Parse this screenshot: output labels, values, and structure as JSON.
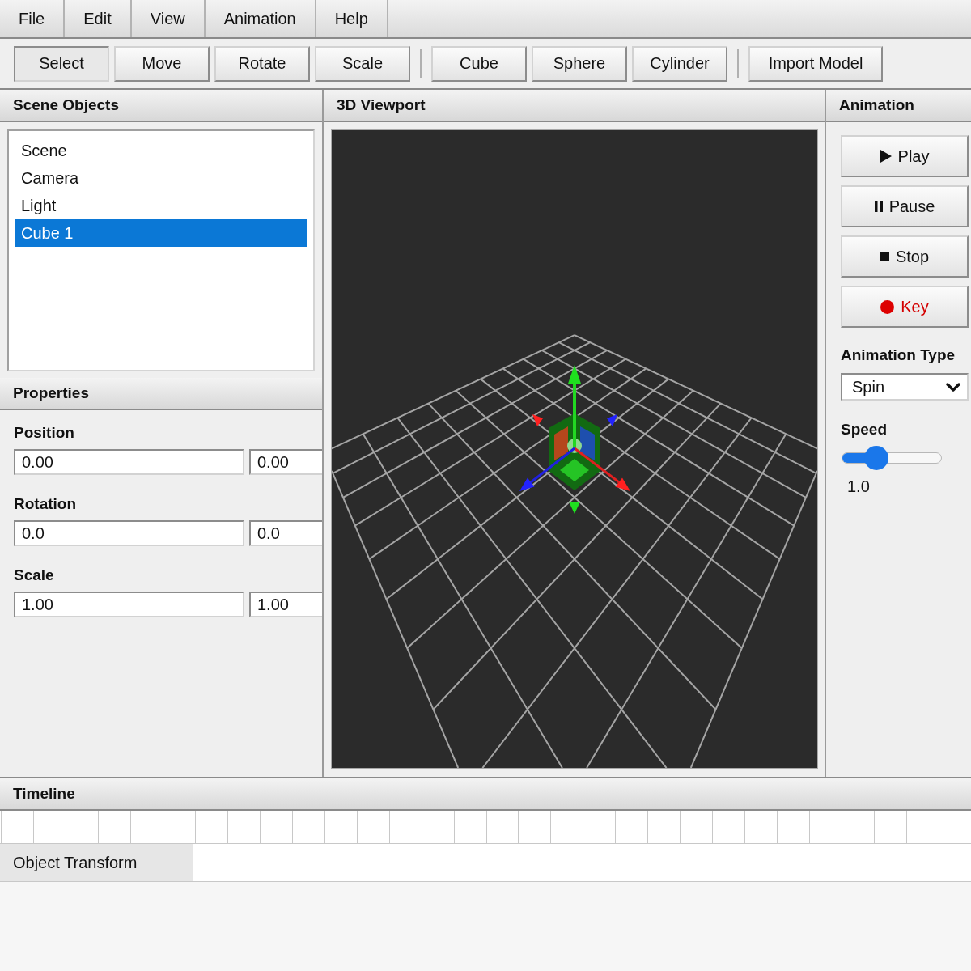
{
  "menu_bar": {
    "items": [
      "File",
      "Edit",
      "View",
      "Animation",
      "Help"
    ]
  },
  "toolbar": {
    "tool_buttons": [
      {
        "label": "Select",
        "selected": true
      },
      {
        "label": "Move",
        "selected": false
      },
      {
        "label": "Rotate",
        "selected": false
      },
      {
        "label": "Scale",
        "selected": false
      }
    ],
    "create_buttons": [
      "Cube",
      "Sphere",
      "Cylinder"
    ],
    "import_button": "Import Model"
  },
  "scene_panel": {
    "title": "Scene Objects",
    "objects": [
      {
        "label": "Scene",
        "selected": false
      },
      {
        "label": "Camera",
        "selected": false
      },
      {
        "label": "Light",
        "selected": false
      },
      {
        "label": "Cube 1",
        "selected": true
      }
    ]
  },
  "properties_panel": {
    "title": "Properties",
    "groups": [
      {
        "label": "Position",
        "values": [
          "0.00",
          "0.00"
        ]
      },
      {
        "label": "Rotation",
        "values": [
          "0.0",
          "0.0"
        ]
      },
      {
        "label": "Scale",
        "values": [
          "1.00",
          "1.00"
        ]
      }
    ]
  },
  "viewport": {
    "title": "3D Viewport"
  },
  "animation_panel": {
    "title": "Animation",
    "buttons": [
      {
        "kind": "play",
        "label": "Play"
      },
      {
        "kind": "pause",
        "label": "Pause"
      },
      {
        "kind": "stop",
        "label": "Stop"
      },
      {
        "kind": "record",
        "label": "Key"
      }
    ],
    "type_label": "Animation Type",
    "type_value": "Spin",
    "speed_label": "Speed",
    "speed": {
      "level": 0.3,
      "reading": "1.0"
    }
  },
  "timeline": {
    "title": "Timeline",
    "tracks": [
      {
        "label": "Object Transform"
      }
    ]
  }
}
